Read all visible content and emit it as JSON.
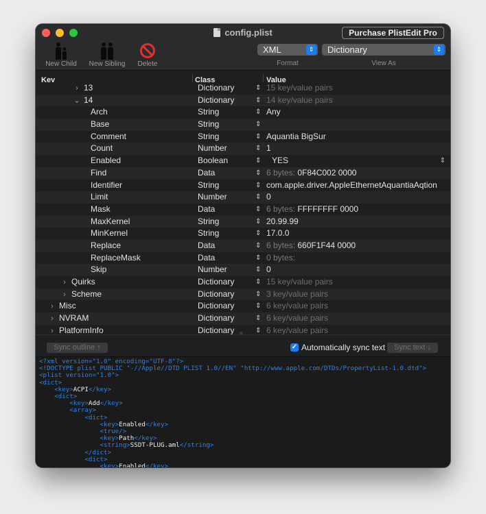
{
  "window": {
    "title": "config.plist",
    "purchase_button": "Purchase PlistEdit Pro"
  },
  "toolbar": {
    "new_child": "New Child",
    "new_sibling": "New Sibling",
    "delete": "Delete",
    "format": {
      "label": "Format",
      "value": "XML"
    },
    "view_as": {
      "label": "View As",
      "value": "Dictionary"
    }
  },
  "columns": {
    "key": "Key",
    "class": "Class",
    "value": "Value"
  },
  "rows": [
    {
      "key": "13",
      "indent": 2,
      "disclosure": "›",
      "class": "Dictionary",
      "value": "15 key/value pairs",
      "muted": true,
      "partial": true
    },
    {
      "key": "14",
      "indent": 2,
      "disclosure": "⌄",
      "class": "Dictionary",
      "value": "14 key/value pairs",
      "muted": true
    },
    {
      "key": "Arch",
      "indent": 3,
      "class": "String",
      "value": "Any"
    },
    {
      "key": "Base",
      "indent": 3,
      "class": "String",
      "value": ""
    },
    {
      "key": "Comment",
      "indent": 3,
      "class": "String",
      "value": "Aquantia BigSur"
    },
    {
      "key": "Count",
      "indent": 3,
      "class": "Number",
      "value": "1"
    },
    {
      "key": "Enabled",
      "indent": 3,
      "class": "Boolean",
      "value": "YES",
      "boolean": true
    },
    {
      "key": "Find",
      "indent": 3,
      "class": "Data",
      "prefix": "6 bytes: ",
      "value": "0F84C002 0000"
    },
    {
      "key": "Identifier",
      "indent": 3,
      "class": "String",
      "value": "com.apple.driver.AppleEthernetAquantiaAqtion"
    },
    {
      "key": "Limit",
      "indent": 3,
      "class": "Number",
      "value": "0"
    },
    {
      "key": "Mask",
      "indent": 3,
      "class": "Data",
      "prefix": "6 bytes: ",
      "value": "FFFFFFFF 0000"
    },
    {
      "key": "MaxKernel",
      "indent": 3,
      "class": "String",
      "value": "20.99.99"
    },
    {
      "key": "MinKernel",
      "indent": 3,
      "class": "String",
      "value": "17.0.0"
    },
    {
      "key": "Replace",
      "indent": 3,
      "class": "Data",
      "prefix": "6 bytes: ",
      "value": "660F1F44 0000"
    },
    {
      "key": "ReplaceMask",
      "indent": 3,
      "class": "Data",
      "prefix": "0 bytes:",
      "value": ""
    },
    {
      "key": "Skip",
      "indent": 3,
      "class": "Number",
      "value": "0"
    },
    {
      "key": "Quirks",
      "indent": 1,
      "disclosure": "›",
      "class": "Dictionary",
      "value": "15 key/value pairs",
      "muted": true
    },
    {
      "key": "Scheme",
      "indent": 1,
      "disclosure": "›",
      "class": "Dictionary",
      "value": "3 key/value pairs",
      "muted": true
    },
    {
      "key": "Misc",
      "indent": 0,
      "disclosure": "›",
      "class": "Dictionary",
      "value": "6 key/value pairs",
      "muted": true
    },
    {
      "key": "NVRAM",
      "indent": 0,
      "disclosure": "›",
      "class": "Dictionary",
      "value": "6 key/value pairs",
      "muted": true
    },
    {
      "key": "PlatformInfo",
      "indent": 0,
      "disclosure": "›",
      "class": "Dictionary",
      "value": "6 key/value pairs",
      "muted": true,
      "partial": true
    }
  ],
  "sync": {
    "sync_outline": "Sync outline ↑",
    "auto_sync_label": "Automatically sync text",
    "auto_sync_checked": true,
    "sync_text": "Sync text ↓"
  },
  "xml_lines": [
    [
      {
        "t": "tag",
        "s": "<?xml version=\"1.0\" encoding=\"UTF-8\"?>"
      }
    ],
    [
      {
        "t": "tag",
        "s": "<!DOCTYPE plist PUBLIC \"-//Apple//DTD PLIST 1.0//EN\" \"http://www.apple.com/DTDs/PropertyList-1.0.dtd\">"
      }
    ],
    [
      {
        "t": "tag",
        "s": "<plist version=\"1.0\">"
      }
    ],
    [
      {
        "t": "tag",
        "s": "<dict>"
      }
    ],
    [
      {
        "t": "tag",
        "s": "    <key>"
      },
      {
        "t": "tx",
        "s": "ACPI"
      },
      {
        "t": "tag",
        "s": "</key>"
      }
    ],
    [
      {
        "t": "tag",
        "s": "    <dict>"
      }
    ],
    [
      {
        "t": "tag",
        "s": "        <key>"
      },
      {
        "t": "tx",
        "s": "Add"
      },
      {
        "t": "tag",
        "s": "</key>"
      }
    ],
    [
      {
        "t": "tag",
        "s": "        <array>"
      }
    ],
    [
      {
        "t": "tag",
        "s": "            <dict>"
      }
    ],
    [
      {
        "t": "tag",
        "s": "                <key>"
      },
      {
        "t": "tx",
        "s": "Enabled"
      },
      {
        "t": "tag",
        "s": "</key>"
      }
    ],
    [
      {
        "t": "tag",
        "s": "                <true/>"
      }
    ],
    [
      {
        "t": "tag",
        "s": "                <key>"
      },
      {
        "t": "tx",
        "s": "Path"
      },
      {
        "t": "tag",
        "s": "</key>"
      }
    ],
    [
      {
        "t": "tag",
        "s": "                <string>"
      },
      {
        "t": "tx",
        "s": "SSDT-PLUG.aml"
      },
      {
        "t": "tag",
        "s": "</string>"
      }
    ],
    [
      {
        "t": "tag",
        "s": "            </dict>"
      }
    ],
    [
      {
        "t": "tag",
        "s": "            <dict>"
      }
    ],
    [
      {
        "t": "tag",
        "s": "                <key>"
      },
      {
        "t": "tx",
        "s": "Enabled"
      },
      {
        "t": "tag",
        "s": "</key>"
      }
    ]
  ]
}
